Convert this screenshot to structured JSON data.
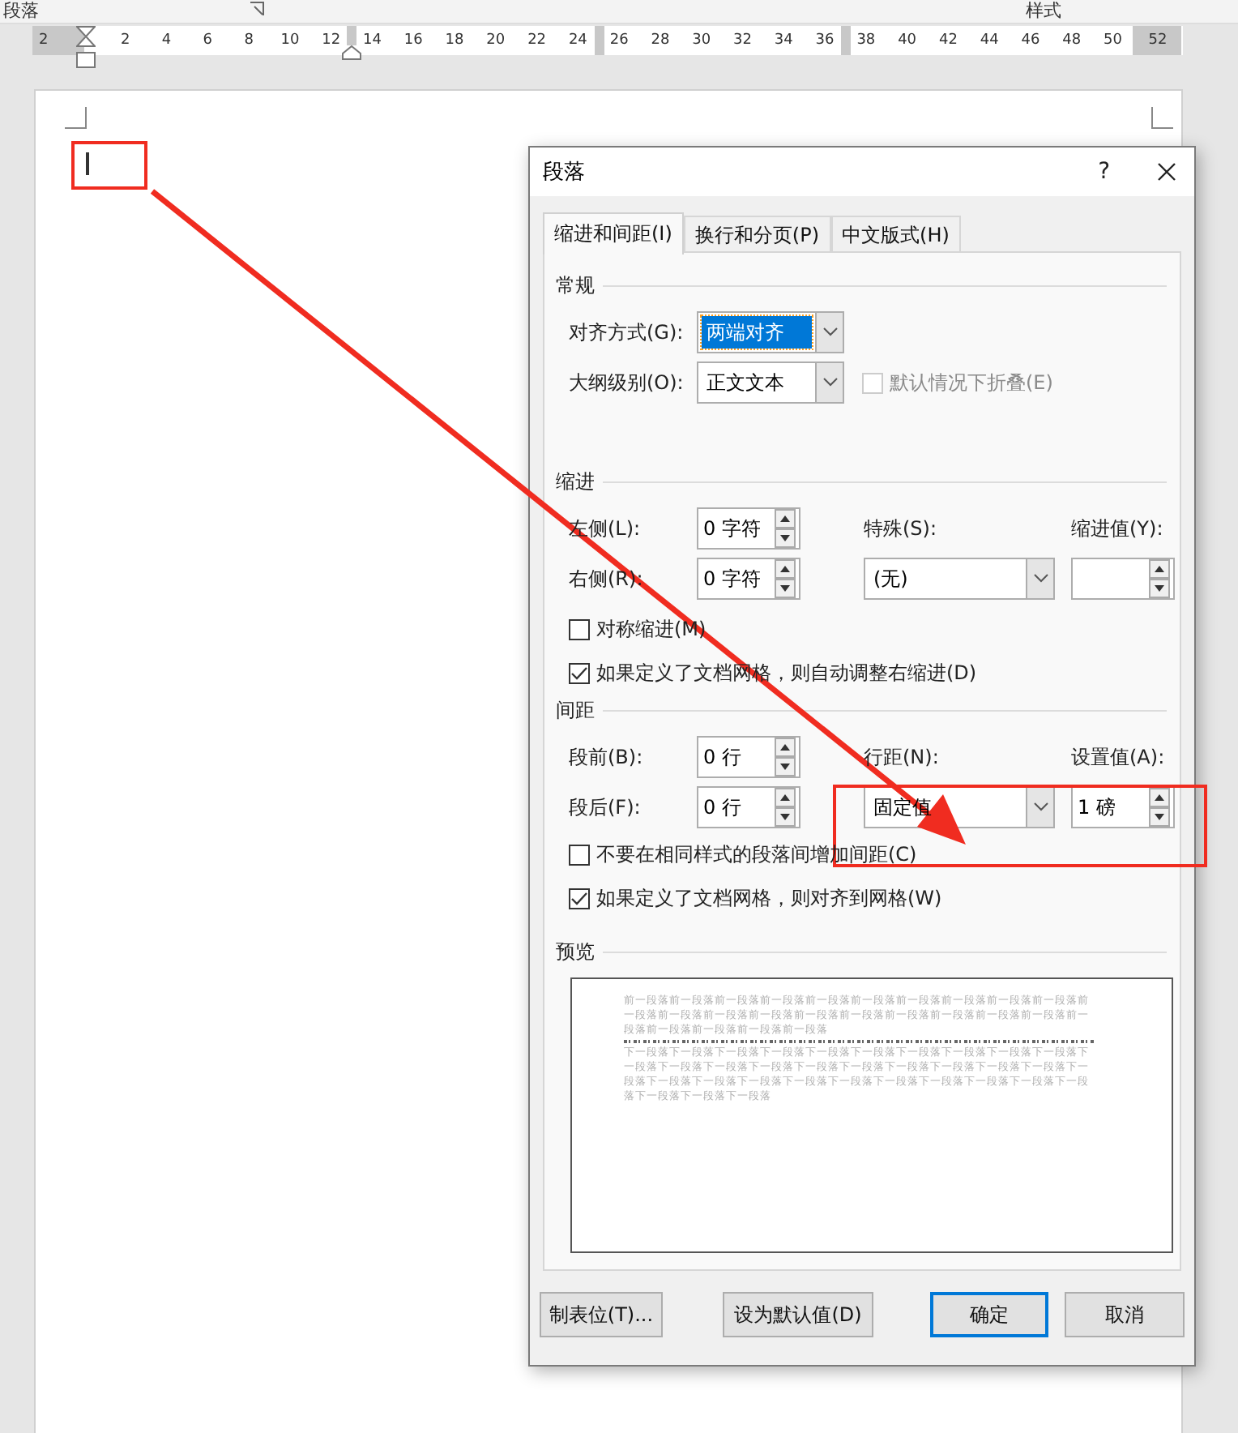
{
  "ribbon": {
    "group_labels": [
      "段落",
      "样式"
    ]
  },
  "ruler": {
    "ticks": [
      {
        "label": "2",
        "margin": true
      },
      {
        "label": "2",
        "margin": false
      },
      {
        "label": "4",
        "margin": false
      },
      {
        "label": "6",
        "margin": false
      },
      {
        "label": "8",
        "margin": false
      },
      {
        "label": "10",
        "margin": false
      },
      {
        "label": "12",
        "margin": false
      },
      {
        "label": "14",
        "margin": false
      },
      {
        "label": "16",
        "margin": false
      },
      {
        "label": "18",
        "margin": false
      },
      {
        "label": "20",
        "margin": false
      },
      {
        "label": "22",
        "margin": false
      },
      {
        "label": "24",
        "margin": false
      },
      {
        "label": "26",
        "margin": false
      },
      {
        "label": "28",
        "margin": false
      },
      {
        "label": "30",
        "margin": false
      },
      {
        "label": "32",
        "margin": false
      },
      {
        "label": "34",
        "margin": false
      },
      {
        "label": "36",
        "margin": false
      },
      {
        "label": "38",
        "margin": false
      },
      {
        "label": "40",
        "margin": false
      },
      {
        "label": "42",
        "margin": false
      },
      {
        "label": "44",
        "margin": false
      },
      {
        "label": "46",
        "margin": false
      },
      {
        "label": "48",
        "margin": false
      },
      {
        "label": "50",
        "margin": false
      },
      {
        "label": "52",
        "margin": true
      }
    ]
  },
  "dialog": {
    "title": "段落",
    "help": "?",
    "tabs": [
      {
        "label": "缩进和间距(I)",
        "selected": true
      },
      {
        "label": "换行和分页(P)",
        "selected": false
      },
      {
        "label": "中文版式(H)",
        "selected": false
      }
    ],
    "general": {
      "title": "常规",
      "alignment": {
        "kind": "dropdown",
        "label": "对齐方式(G):",
        "value": "两端对齐",
        "highlighted": true
      },
      "outline": {
        "kind": "dropdown",
        "label": "大纲级别(O):",
        "value": "正文文本",
        "highlighted": false
      },
      "collapse": {
        "kind": "checkbox",
        "label": "默认情况下折叠(E)",
        "checked": false,
        "disabled": true
      }
    },
    "indent": {
      "title": "缩进",
      "left": {
        "kind": "spinner",
        "label": "左侧(L):",
        "value": "0 字符"
      },
      "right": {
        "kind": "spinner",
        "label": "右侧(R):",
        "value": "0 字符"
      },
      "special": {
        "kind": "dropdown",
        "label": "特殊(S):",
        "value": "(无)",
        "highlighted": false
      },
      "by": {
        "kind": "spinner",
        "label": "缩进值(Y):"
      },
      "checkboxes": [
        {
          "kind": "checkbox",
          "label": "对称缩进(M)",
          "checked": false,
          "disabled": false
        },
        {
          "kind": "checkbox",
          "label": "如果定义了文档网格，则自动调整右缩进(D)",
          "checked": true,
          "disabled": false
        }
      ]
    },
    "spacing": {
      "title": "间距",
      "before": {
        "kind": "spinner",
        "label": "段前(B):",
        "value": "0 行"
      },
      "after": {
        "kind": "spinner",
        "label": "段后(F):",
        "value": "0 行"
      },
      "line": {
        "kind": "dropdown",
        "label": "行距(N):",
        "value": "固定值",
        "highlighted": false
      },
      "at": {
        "kind": "spinner",
        "label": "设置值(A):",
        "value": "1 磅"
      },
      "checkboxes": [
        {
          "kind": "checkbox",
          "label": "不要在相同样式的段落间增加间距(C)",
          "checked": false,
          "disabled": false
        },
        {
          "kind": "checkbox",
          "label": "如果定义了文档网格，则对齐到网格(W)",
          "checked": true,
          "disabled": false
        }
      ]
    },
    "preview": {
      "title": "预览",
      "previous_text": "前一段落前一段落前一段落前一段落前一段落前一段落前一段落前一段落前一段落前一段落前一段落前一段落前一段落前一段落前一段落前一段落前一段落前一段落前一段落前一段落前一段落前一段落前一段落前一段落前一段落",
      "following_text": "下一段落下一段落下一段落下一段落下一段落下一段落下一段落下一段落下一段落下一段落下一段落下一段落下一段落下一段落下一段落下一段落下一段落下一段落下一段落下一段落下一段落下一段落下一段落下一段落下一段落下一段落下一段落下一段落下一段落下一段落下一段落下一段落下一段落下一段落"
    },
    "buttons": [
      {
        "label": "制表位(T)...",
        "default": false
      },
      {
        "label": "设为默认值(D)",
        "default": false
      },
      {
        "label": "确定",
        "default": true
      },
      {
        "label": "取消",
        "default": false
      }
    ]
  }
}
